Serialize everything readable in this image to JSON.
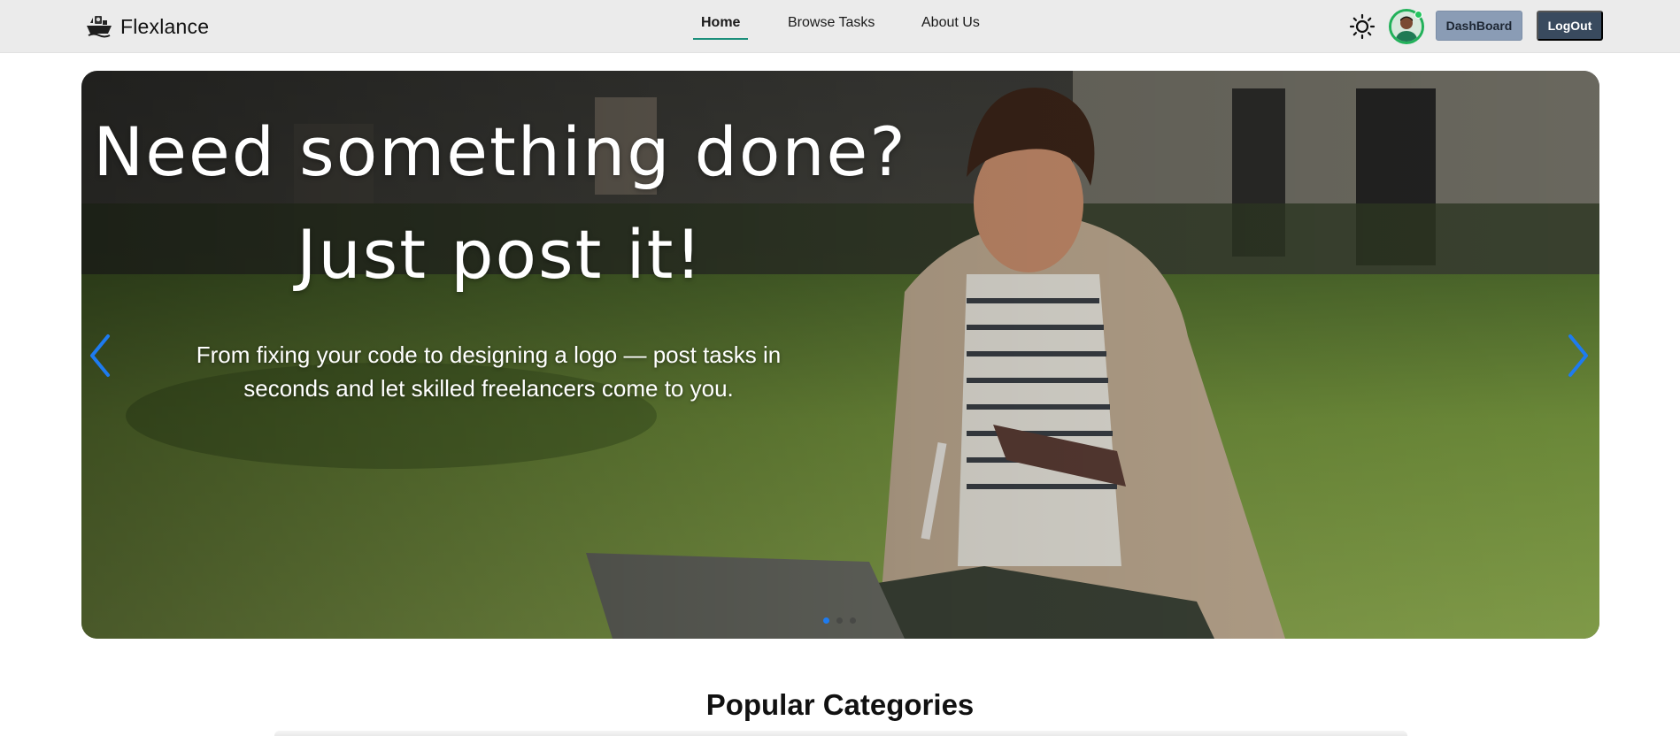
{
  "brand": {
    "name": "Flexlance",
    "logo_icon": "boat-logo-icon"
  },
  "nav": {
    "links": [
      {
        "label": "Home",
        "active": true
      },
      {
        "label": "Browse Tasks",
        "active": false
      },
      {
        "label": "About Us",
        "active": false
      }
    ],
    "active_color": "#1c8f7b"
  },
  "header_actions": {
    "theme_icon": "sun-icon",
    "avatar_online": true,
    "dashboard_label": "DashBoard",
    "logout_label": "LogOut"
  },
  "hero": {
    "headline_line1": "Need something done?",
    "headline_line2": "Just post it!",
    "subtitle_line1": "From fixing your code to designing a logo — post tasks in",
    "subtitle_line2": "seconds and let skilled freelancers come to you.",
    "slide_count": 3,
    "active_slide": 1,
    "arrow_color": "#1e7bf0"
  },
  "categories": {
    "title": "Popular Categories"
  }
}
